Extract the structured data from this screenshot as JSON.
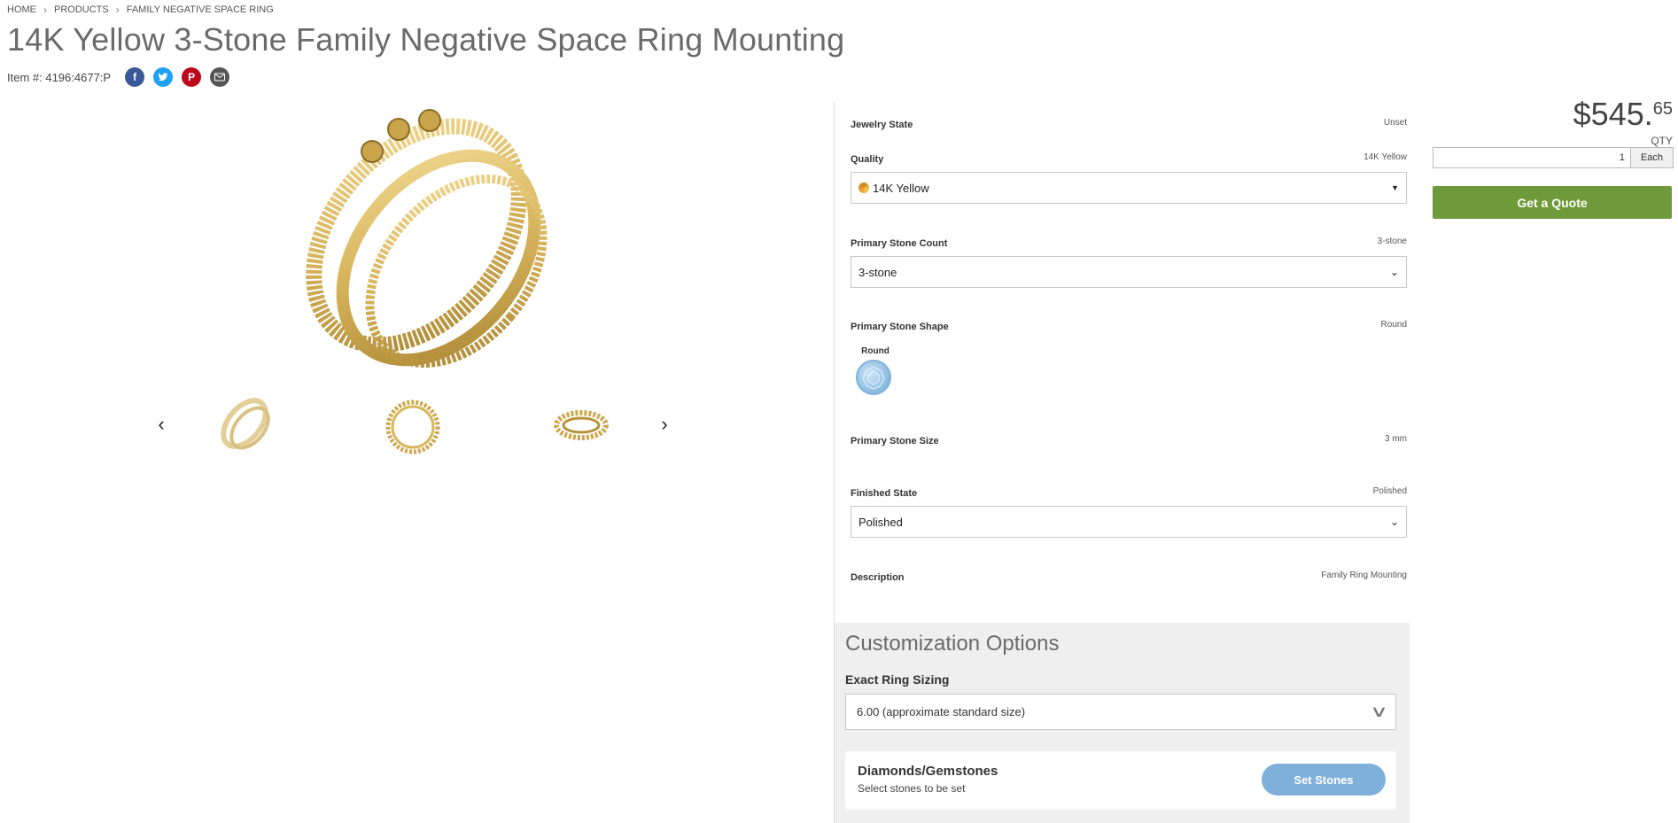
{
  "breadcrumb": {
    "items": [
      "HOME",
      "PRODUCTS",
      "FAMILY NEGATIVE SPACE RING"
    ],
    "separator": ">"
  },
  "product": {
    "title": "14K Yellow 3-Stone Family Negative Space Ring Mounting",
    "item_number": "Item #: 4196:4677:P",
    "share_icons": [
      "facebook-icon",
      "twitter-icon",
      "pinterest-icon",
      "email-icon"
    ]
  },
  "gallery": {
    "prev_arrow": "‹",
    "next_arrow": "›",
    "thumbnails": [
      "ring-angle-view",
      "ring-front-view",
      "ring-top-view"
    ]
  },
  "options": {
    "jewelry_state": {
      "label": "Jewelry State",
      "value": "Unset"
    },
    "quality": {
      "label": "Quality",
      "value": "14K Yellow",
      "selected": "14K Yellow"
    },
    "stone_count": {
      "label": "Primary Stone Count",
      "value": "3-stone",
      "selected": "3-stone"
    },
    "stone_shape": {
      "label": "Primary Stone Shape",
      "value": "Round",
      "swatch_label": "Round"
    },
    "stone_size": {
      "label": "Primary Stone Size",
      "value": "3 mm"
    },
    "finished_state": {
      "label": "Finished State",
      "value": "Polished",
      "selected": "Polished"
    },
    "description": {
      "label": "Description",
      "value": "Family Ring Mounting"
    }
  },
  "customization": {
    "title": "Customization Options",
    "ring_sizing_label": "Exact Ring Sizing",
    "ring_sizing_value": "6.00 (approximate standard size)",
    "stones_title": "Diamonds/Gemstones",
    "stones_subtitle": "Select stones to be set",
    "set_stones_label": "Set Stones"
  },
  "purchase": {
    "price_dollars": "$545.",
    "price_cents": "65",
    "qty_label": "QTY",
    "qty_value": "1",
    "qty_unit": "Each",
    "quote_label": "Get a Quote"
  },
  "colors": {
    "quote_button": "#6e9a3b",
    "set_stones_button": "#7fb0da",
    "gold": "#d6b35a"
  }
}
